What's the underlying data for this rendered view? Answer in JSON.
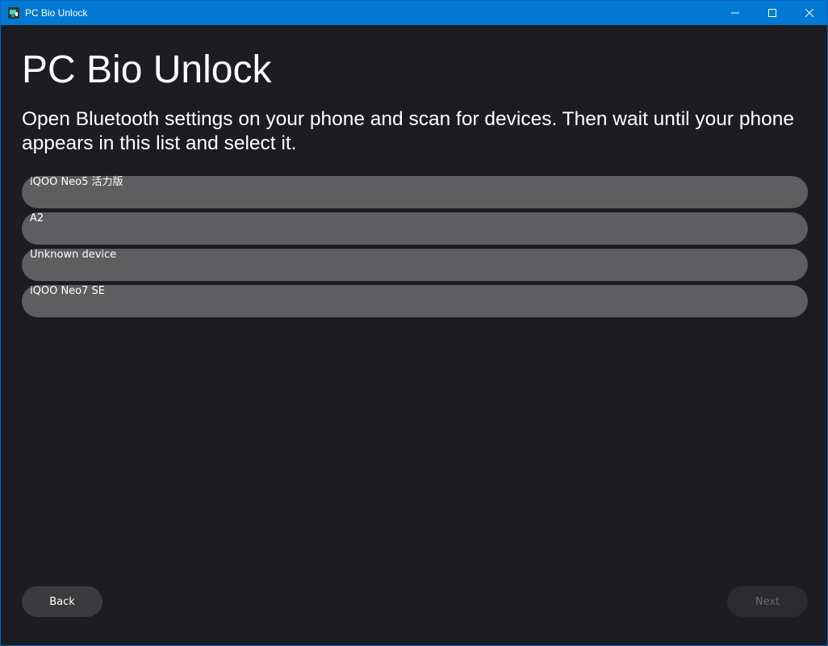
{
  "window": {
    "title": "PC Bio Unlock",
    "controls": {
      "minimize_icon": "minimize-icon",
      "maximize_icon": "maximize-icon",
      "close_icon": "close-icon"
    }
  },
  "page": {
    "title": "PC Bio Unlock",
    "instructions": "Open Bluetooth settings on your phone and scan for devices. Then wait until your phone appears in this list and select it."
  },
  "devices": [
    {
      "label": "iQOO Neo5 活力版"
    },
    {
      "label": "A2"
    },
    {
      "label": "Unknown device"
    },
    {
      "label": "iQOO Neo7 SE"
    }
  ],
  "buttons": {
    "back_label": "Back",
    "next_label": "Next",
    "next_enabled": false
  },
  "colors": {
    "titlebar": "#0078d4",
    "background": "#1d1d21",
    "list_item": "#5e5e60",
    "back_button": "#3b3b3e",
    "next_button_disabled": "#2b2b2e"
  }
}
